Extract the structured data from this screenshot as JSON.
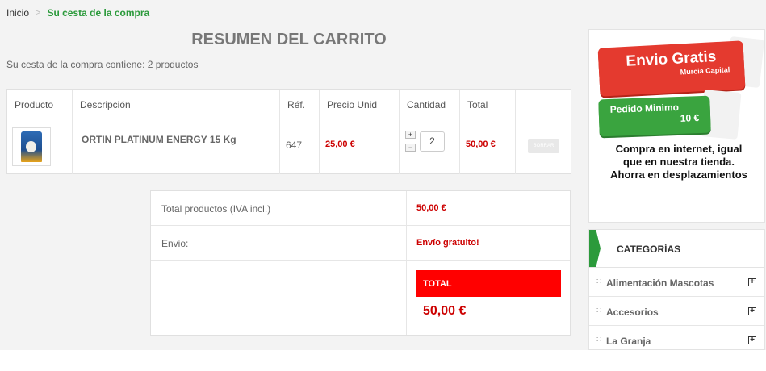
{
  "breadcrumb": {
    "home": "Inicio",
    "separator": ">",
    "current": "Su cesta de la compra"
  },
  "page_title": "RESUMEN DEL CARRITO",
  "cart_summary": "Su cesta de la compra contiene: 2 productos",
  "cart_table": {
    "headers": [
      "Producto",
      "Descripción",
      "Réf.",
      "Precio Unid",
      "Cantidad",
      "Total",
      ""
    ],
    "items": [
      {
        "description": "ORTIN PLATINUM ENERGY 15 Kg",
        "ref": "647",
        "unit_price": "25,00 €",
        "quantity": "2",
        "total": "50,00 €",
        "plus_label": "+",
        "minus_label": "−",
        "delete_label": "BORRAR"
      }
    ]
  },
  "totals": {
    "products_label": "Total productos (IVA incl.)",
    "products_value": "50,00 €",
    "shipping_label": "Envio:",
    "shipping_value": "Envío gratuito!",
    "total_label": "TOTAL",
    "total_value": "50,00 €"
  },
  "promo": {
    "ribbon1_big": "Envio Gratis",
    "ribbon1_small": "Murcia Capital",
    "ribbon2_line1": "Pedido Minimo",
    "ribbon2_line2": "10 €",
    "text_lines": [
      "Compra en internet, igual",
      "que en nuestra tienda.",
      "Ahorra en desplazamientos"
    ]
  },
  "categories": {
    "title": "CATEGORÍAS",
    "items": [
      {
        "name": "Alimentación Mascotas",
        "expand": "+"
      },
      {
        "name": "Accesorios",
        "expand": "+"
      },
      {
        "name": "La Granja",
        "expand": "+"
      }
    ]
  },
  "colors": {
    "accent_green": "#2b9a3b",
    "price_red": "#cc0000",
    "total_bar": "#ff0000"
  }
}
